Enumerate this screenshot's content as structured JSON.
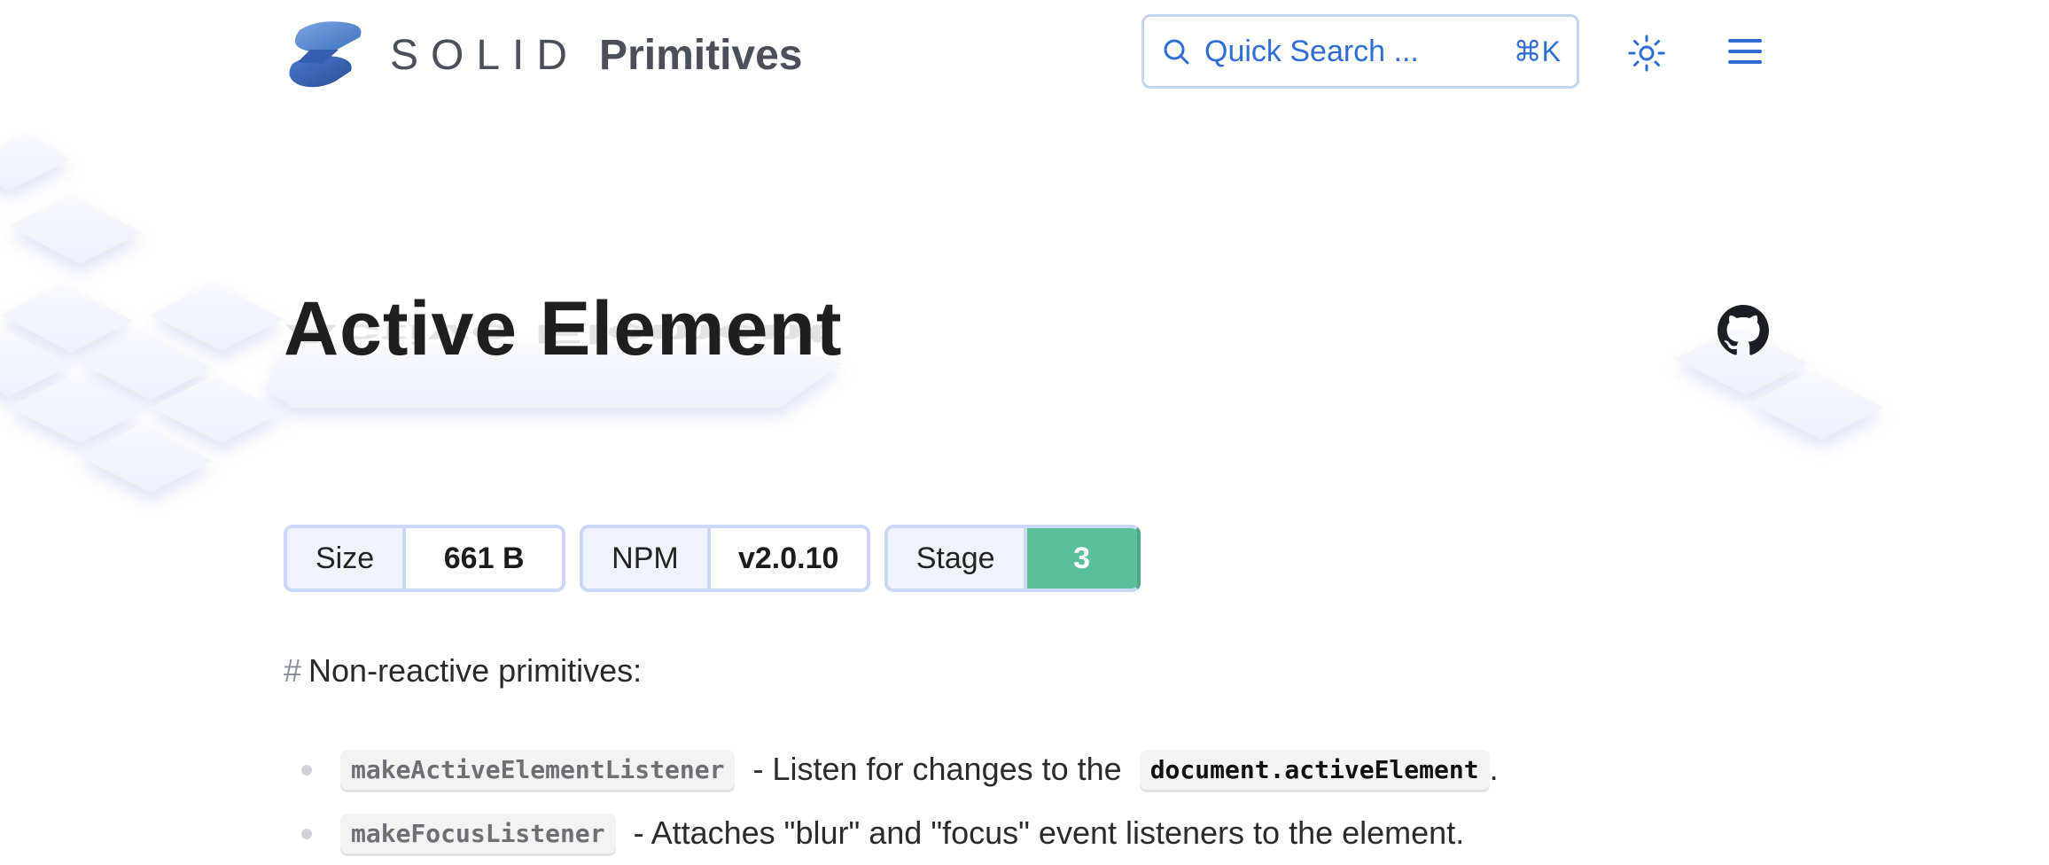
{
  "brand": {
    "solid": "SOLID",
    "primitives": "Primitives"
  },
  "search": {
    "label": "Quick Search ...",
    "shortcut": "⌘K"
  },
  "page": {
    "title": "Active Element"
  },
  "badges": [
    {
      "key": "Size",
      "value": "661 B"
    },
    {
      "key": "NPM",
      "value": "v2.0.10"
    },
    {
      "key": "Stage",
      "value": "3"
    }
  ],
  "section": {
    "hash": "#",
    "heading": "Non-reactive primitives:"
  },
  "list": [
    {
      "code": "makeActiveElementListener",
      "text_before": " - Listen for changes to the ",
      "code2": "document.activeElement",
      "text_after": "."
    },
    {
      "code": "makeFocusListener",
      "text_before": " - Attaches \"blur\" and \"focus\" event listeners to the element."
    }
  ],
  "colors": {
    "accent": "#2f6fd4",
    "stage": "#5bbf9c",
    "badge_border": "#ccd7f5"
  },
  "icons": {
    "logo": "solid-logo-icon",
    "search": "search-icon",
    "theme": "sun-icon",
    "menu": "hamburger-menu-icon",
    "github": "github-icon"
  }
}
